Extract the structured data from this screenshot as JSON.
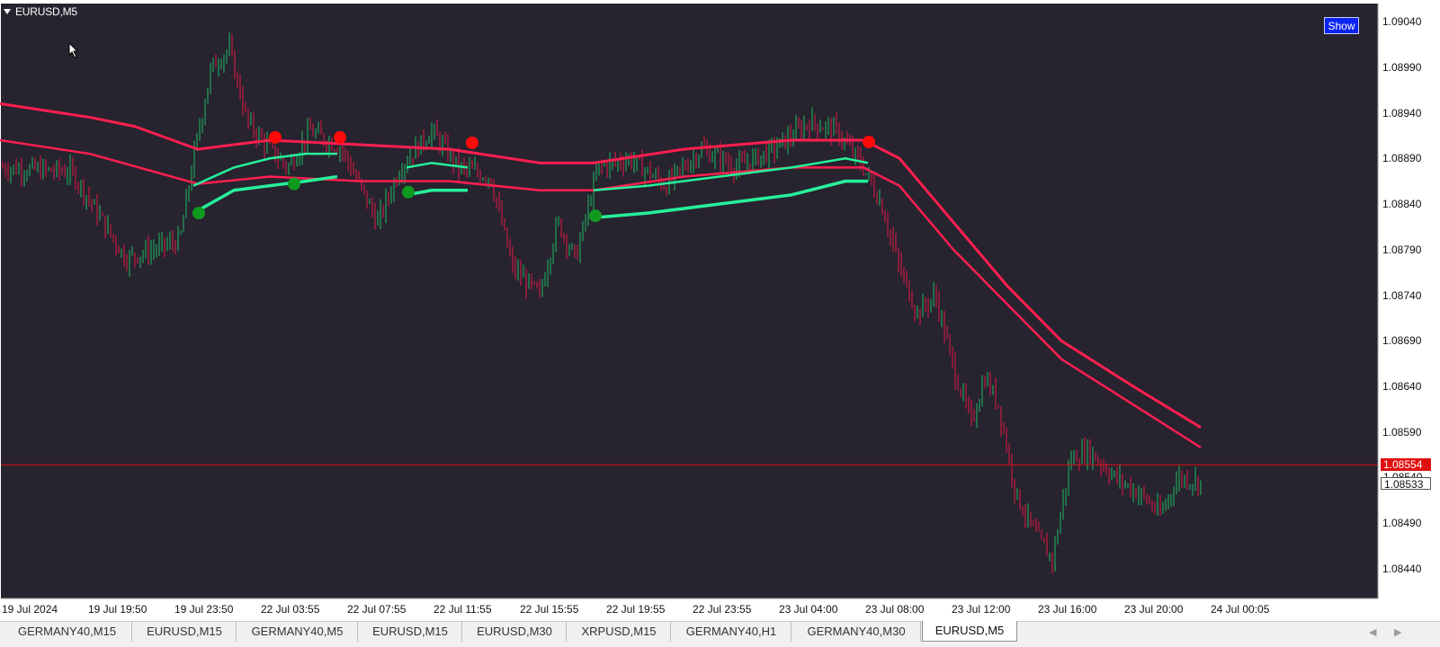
{
  "chart": {
    "symbol_label": "EURUSD,M5",
    "show_button": "Show",
    "colors": {
      "background": "#27232f",
      "bull_candle": "#1fa25a",
      "bear_candle": "#c21c43",
      "band_upper": "#ff1f4f",
      "band_lower": "#27f09a",
      "signal_sell": "#ff0a0a",
      "signal_buy": "#0f9a1f",
      "bid_line": "#e01010"
    },
    "price_axis": [
      "1.09040",
      "1.08990",
      "1.08940",
      "1.08890",
      "1.08840",
      "1.08790",
      "1.08740",
      "1.08690",
      "1.08640",
      "1.08590",
      "1.08490",
      "1.08440"
    ],
    "time_axis": [
      "19 Jul 2024",
      "19 Jul 19:50",
      "19 Jul 23:50",
      "22 Jul 03:55",
      "22 Jul 07:55",
      "22 Jul 11:55",
      "22 Jul 15:55",
      "22 Jul 19:55",
      "22 Jul 23:55",
      "23 Jul 04:00",
      "23 Jul 08:00",
      "23 Jul 12:00",
      "23 Jul 16:00",
      "23 Jul 20:00",
      "24 Jul 00:05"
    ],
    "bid_price": "1.08554",
    "ask_overlap_price": "1.08540",
    "last_price": "1.08533",
    "price_min": 1.0842,
    "price_max": 1.0906,
    "anchors": [
      [
        0,
        1.0888
      ],
      [
        80,
        1.08875
      ],
      [
        140,
        1.0878
      ],
      [
        200,
        1.088
      ],
      [
        215,
        1.0889
      ],
      [
        235,
        1.0899
      ],
      [
        255,
        1.0901
      ],
      [
        275,
        1.0893
      ],
      [
        300,
        1.089
      ],
      [
        320,
        1.0888
      ],
      [
        345,
        1.0892
      ],
      [
        380,
        1.089
      ],
      [
        420,
        1.0882
      ],
      [
        445,
        1.0888
      ],
      [
        480,
        1.0892
      ],
      [
        510,
        1.0888
      ],
      [
        545,
        1.0887
      ],
      [
        570,
        1.0877
      ],
      [
        600,
        1.0874
      ],
      [
        620,
        1.0882
      ],
      [
        640,
        1.0878
      ],
      [
        665,
        1.0888
      ],
      [
        700,
        1.0889
      ],
      [
        740,
        1.0886
      ],
      [
        780,
        1.089
      ],
      [
        820,
        1.0888
      ],
      [
        860,
        1.089
      ],
      [
        900,
        1.0893
      ],
      [
        930,
        1.0892
      ],
      [
        960,
        1.0888
      ],
      [
        980,
        1.0884
      ],
      [
        1000,
        1.0877
      ],
      [
        1020,
        1.0872
      ],
      [
        1040,
        1.0874
      ],
      [
        1060,
        1.0866
      ],
      [
        1080,
        1.086
      ],
      [
        1095,
        1.0865
      ],
      [
        1110,
        1.0862
      ],
      [
        1130,
        1.0852
      ],
      [
        1150,
        1.0848
      ],
      [
        1170,
        1.0845
      ],
      [
        1190,
        1.0856
      ],
      [
        1210,
        1.0857
      ],
      [
        1240,
        1.0854
      ],
      [
        1270,
        1.0852
      ],
      [
        1290,
        1.085
      ],
      [
        1310,
        1.0854
      ],
      [
        1335,
        1.08535
      ]
    ],
    "upper_band": [
      [
        0,
        1.0895
      ],
      [
        100,
        1.08935
      ],
      [
        150,
        1.08925
      ],
      [
        220,
        1.089
      ],
      [
        300,
        1.0891
      ],
      [
        400,
        1.08905
      ],
      [
        500,
        1.089
      ],
      [
        600,
        1.08885
      ],
      [
        660,
        1.08885
      ],
      [
        760,
        1.089
      ],
      [
        880,
        1.0891
      ],
      [
        960,
        1.0891
      ],
      [
        1000,
        1.0889
      ],
      [
        1060,
        1.0882
      ],
      [
        1120,
        1.0875
      ],
      [
        1180,
        1.0869
      ],
      [
        1260,
        1.0864
      ],
      [
        1335,
        1.08595
      ]
    ],
    "upper_band_inner": [
      [
        0,
        1.0891
      ],
      [
        100,
        1.08895
      ],
      [
        220,
        1.08862
      ],
      [
        300,
        1.0887
      ],
      [
        400,
        1.08865
      ],
      [
        500,
        1.08865
      ],
      [
        600,
        1.08855
      ],
      [
        660,
        1.08855
      ],
      [
        760,
        1.0887
      ],
      [
        880,
        1.0888
      ],
      [
        960,
        1.0888
      ],
      [
        1000,
        1.0886
      ],
      [
        1060,
        1.0879
      ],
      [
        1120,
        1.0873
      ],
      [
        1180,
        1.0867
      ],
      [
        1260,
        1.0862
      ],
      [
        1335,
        1.08573
      ]
    ],
    "lower_band_1": [
      [
        215,
        1.0886
      ],
      [
        260,
        1.0888
      ],
      [
        300,
        1.0889
      ],
      [
        340,
        1.08895
      ],
      [
        375,
        1.08895
      ]
    ],
    "lower_band_2": [
      [
        215,
        1.0883
      ],
      [
        260,
        1.08855
      ],
      [
        300,
        1.0886
      ],
      [
        340,
        1.08865
      ],
      [
        375,
        1.0887
      ]
    ],
    "lower_band_3": [
      [
        452,
        1.0888
      ],
      [
        480,
        1.08885
      ],
      [
        520,
        1.0888
      ]
    ],
    "lower_band_4": [
      [
        452,
        1.0885
      ],
      [
        480,
        1.08855
      ],
      [
        520,
        1.08855
      ]
    ],
    "lower_band_5": [
      [
        660,
        1.08855
      ],
      [
        720,
        1.0886
      ],
      [
        800,
        1.0887
      ],
      [
        880,
        1.0888
      ],
      [
        940,
        1.0889
      ],
      [
        965,
        1.08885
      ]
    ],
    "lower_band_6": [
      [
        660,
        1.08825
      ],
      [
        720,
        1.0883
      ],
      [
        800,
        1.0884
      ],
      [
        880,
        1.0885
      ],
      [
        940,
        1.08865
      ],
      [
        965,
        1.08865
      ]
    ],
    "sell_signals": [
      [
        306,
        1.08913
      ],
      [
        378,
        1.08913
      ],
      [
        525,
        1.08907
      ],
      [
        966,
        1.08908
      ]
    ],
    "buy_signals": [
      [
        221,
        1.0883
      ],
      [
        327,
        1.08862
      ],
      [
        454,
        1.08853
      ],
      [
        662,
        1.08827
      ]
    ]
  },
  "tabs": [
    {
      "label": "GERMANY40,M15"
    },
    {
      "label": "EURUSD,M15"
    },
    {
      "label": "GERMANY40,M5"
    },
    {
      "label": "EURUSD,M15"
    },
    {
      "label": "EURUSD,M30"
    },
    {
      "label": "XRPUSD,M15"
    },
    {
      "label": "GERMANY40,H1"
    },
    {
      "label": "GERMANY40,M30"
    },
    {
      "label": "EURUSD,M5"
    }
  ],
  "active_tab": 8,
  "tab_nav": {
    "prev": "◀",
    "next": "▶"
  }
}
